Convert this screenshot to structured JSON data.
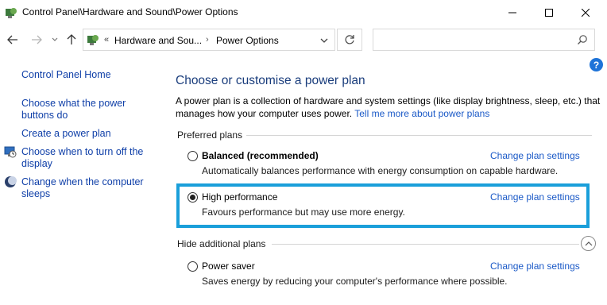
{
  "window": {
    "title": "Control Panel\\Hardware and Sound\\Power Options",
    "minimize_label": "minimize",
    "maximize_label": "maximize",
    "close_label": "close"
  },
  "address": {
    "prefix": "«",
    "crumb1": "Hardware and Sou...",
    "separator": "›",
    "crumb2": "Power Options",
    "search_placeholder": ""
  },
  "help": {
    "label": "?"
  },
  "sidebar": {
    "home": "Control Panel Home",
    "items": [
      {
        "label": "Choose what the power buttons do",
        "line1": "Choose what the power",
        "line2": "buttons do",
        "icon": "none"
      },
      {
        "label": "Create a power plan",
        "line1": "Create a power plan",
        "line2": "",
        "icon": "none"
      },
      {
        "label": "Choose when to turn off the display",
        "line1": "Choose when to turn off the",
        "line2": "display",
        "icon": "display-clock-icon"
      },
      {
        "label": "Change when the computer sleeps",
        "line1": "Change when the computer",
        "line2": "sleeps",
        "icon": "moon-icon"
      }
    ]
  },
  "main": {
    "heading": "Choose or customise a power plan",
    "intro_line1": "A power plan is a collection of hardware and system settings (like display brightness, sleep, etc.) that",
    "intro_line2": "manages how your computer uses power.",
    "intro_link": "Tell me more about power plans",
    "preferred_label": "Preferred plans",
    "hide_label": "Hide additional plans",
    "plans": [
      {
        "name": "Balanced (recommended)",
        "description": "Automatically balances performance with energy consumption on capable hardware.",
        "change_link": "Change plan settings",
        "selected": false,
        "bold": true
      },
      {
        "name": "High performance",
        "description": "Favours performance but may use more energy.",
        "change_link": "Change plan settings",
        "selected": true,
        "bold": false
      },
      {
        "name": "Power saver",
        "description": "Saves energy by reducing your computer's performance where possible.",
        "change_link": "Change plan settings",
        "selected": false,
        "bold": false
      }
    ]
  },
  "colors": {
    "link": "#1a59c7",
    "heading": "#1a3d7c",
    "highlight_border": "#1a9fda",
    "help_bg": "#1e73d8"
  }
}
